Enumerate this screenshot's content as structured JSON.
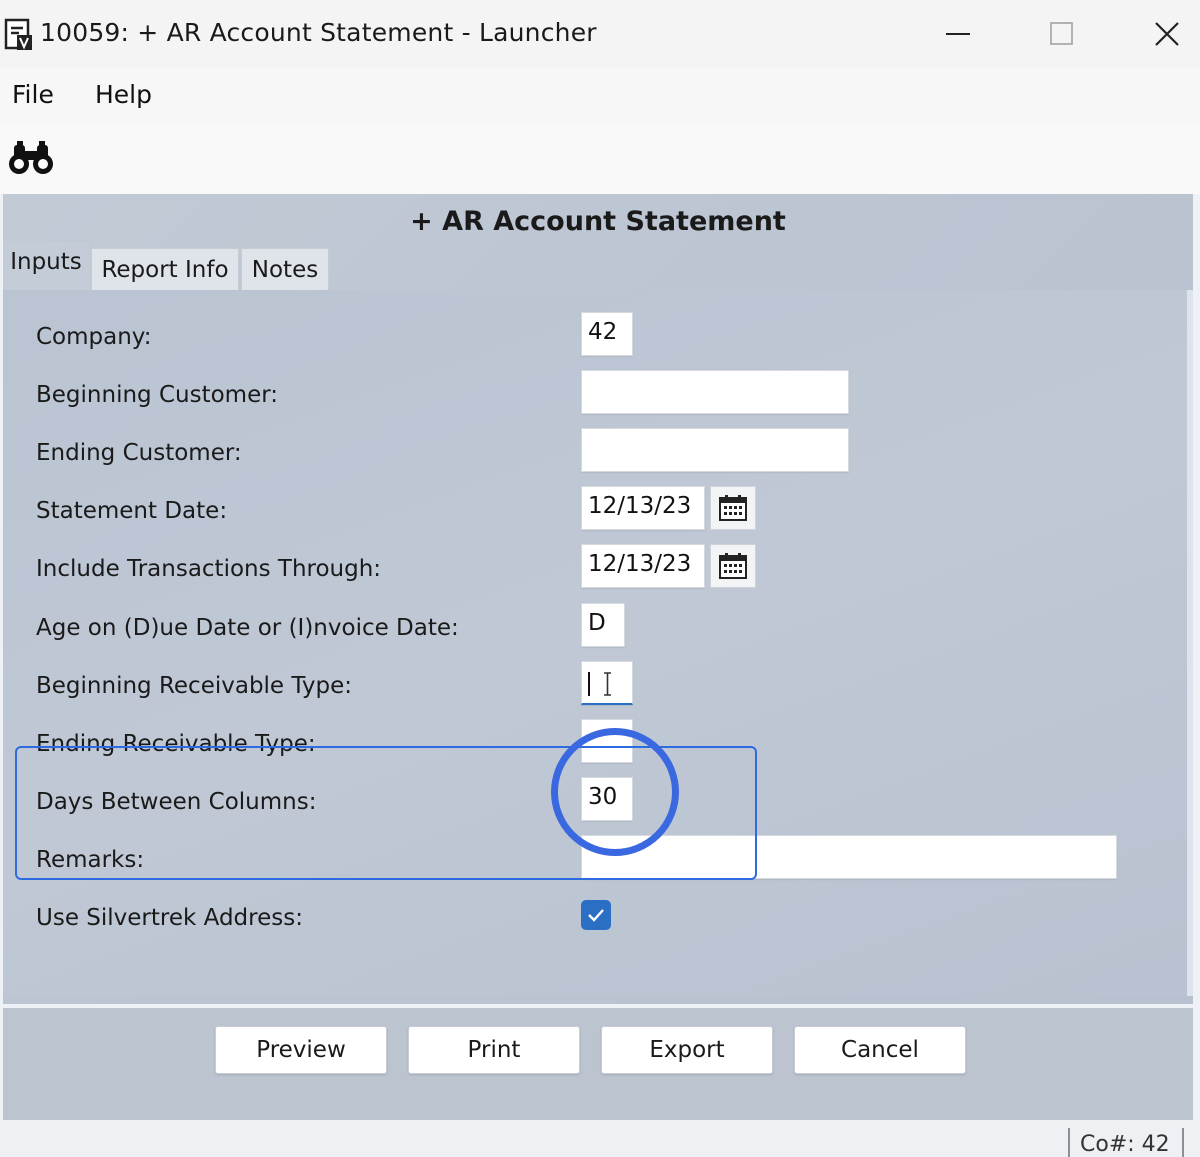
{
  "window": {
    "title": "10059: + AR Account Statement - Launcher",
    "app_icon": "report-app-icon",
    "controls": [
      "minimize-icon",
      "maximize-icon",
      "close-icon"
    ]
  },
  "menu": {
    "file": "File",
    "help": "Help"
  },
  "toolbar": {
    "icons": [
      "binoculars-icon"
    ]
  },
  "form": {
    "title": "+ AR Account Statement",
    "tabs": [
      {
        "label": "Inputs",
        "active": true
      },
      {
        "label": "Report Info",
        "active": false
      },
      {
        "label": "Notes",
        "active": false
      }
    ],
    "fields": [
      {
        "label": "Company:",
        "value": "42"
      },
      {
        "label": "Beginning Customer:",
        "value": ""
      },
      {
        "label": "Ending Customer:",
        "value": ""
      },
      {
        "label": "Statement Date:",
        "value": "12/13/23"
      },
      {
        "label": "Include Transactions Through:",
        "value": "12/13/23"
      },
      {
        "label": "Age on (D)ue Date or (I)nvoice Date:",
        "value": "D"
      },
      {
        "label": "Beginning Receivable Type:",
        "value": ""
      },
      {
        "label": "Ending Receivable Type:",
        "value": ""
      },
      {
        "label": "Days Between Columns:",
        "value": "30"
      },
      {
        "label": "Remarks:",
        "value": ""
      },
      {
        "label": "Use Silvertrek Address:",
        "checked": true
      }
    ]
  },
  "buttons": {
    "preview": "Preview",
    "print": "Print",
    "export": "Export",
    "cancel": "Cancel"
  },
  "status": {
    "company": "Co#: 42"
  },
  "colors": {
    "highlight": "#2f6be0",
    "checkbox": "#2b6fc4",
    "panel": "#bcc5d2"
  }
}
